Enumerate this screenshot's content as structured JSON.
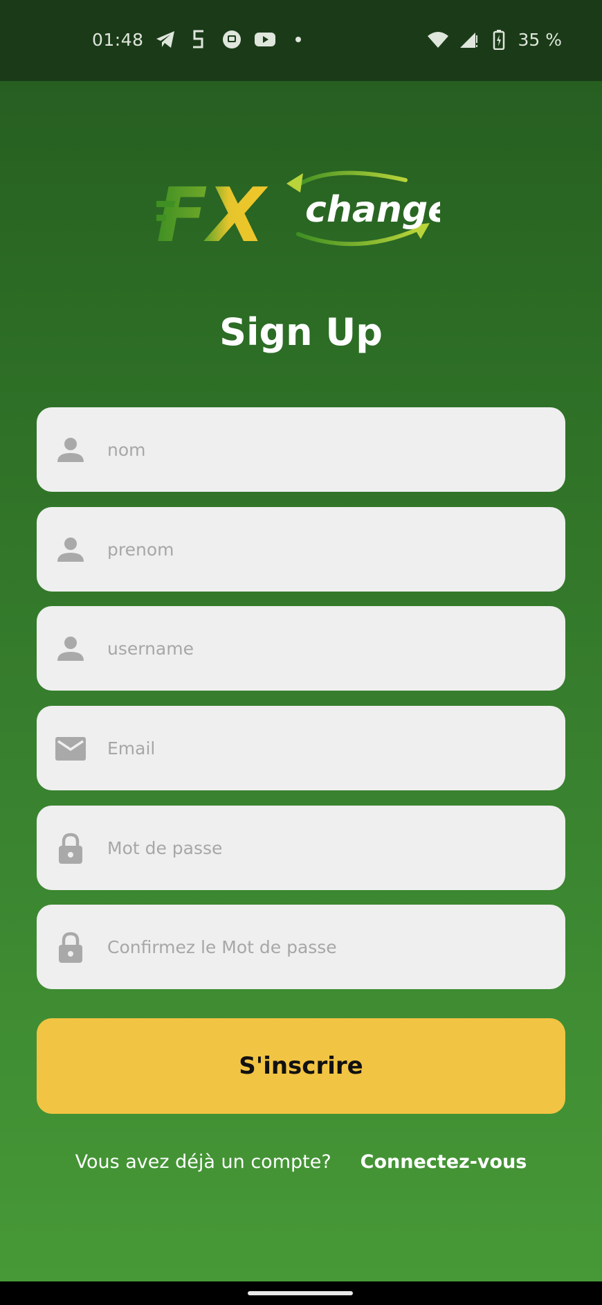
{
  "status_bar": {
    "time": "01:48",
    "notification_icons": [
      "telegram-icon",
      "s-app-icon",
      "app-icon",
      "youtube-icon",
      "dot-icon"
    ],
    "system_icons": [
      "wifi-icon",
      "signal-icon",
      "battery-icon"
    ],
    "battery": "35 %"
  },
  "logo": {
    "brand": "FX",
    "word": "change",
    "colors": {
      "green": "#3f8f23",
      "yellow": "#f0c72a"
    }
  },
  "page": {
    "title": "Sign Up"
  },
  "form": {
    "fields": [
      {
        "placeholder": "nom",
        "icon": "person-icon"
      },
      {
        "placeholder": "prenom",
        "icon": "person-icon"
      },
      {
        "placeholder": "username",
        "icon": "person-icon"
      },
      {
        "placeholder": "Email",
        "icon": "mail-icon"
      },
      {
        "placeholder": "Mot de passe",
        "icon": "lock-icon"
      },
      {
        "placeholder": "Confirmez le Mot de passe",
        "icon": "lock-icon"
      }
    ],
    "submit_label": "S'inscrire"
  },
  "footer": {
    "prompt": "Vous avez déjà un compte?",
    "link": "Connectez-vous"
  },
  "colors": {
    "accent": "#f2c443",
    "field_bg": "#efefef",
    "placeholder": "#a7a7a7",
    "status_bar_bg": "#1b3b18"
  }
}
